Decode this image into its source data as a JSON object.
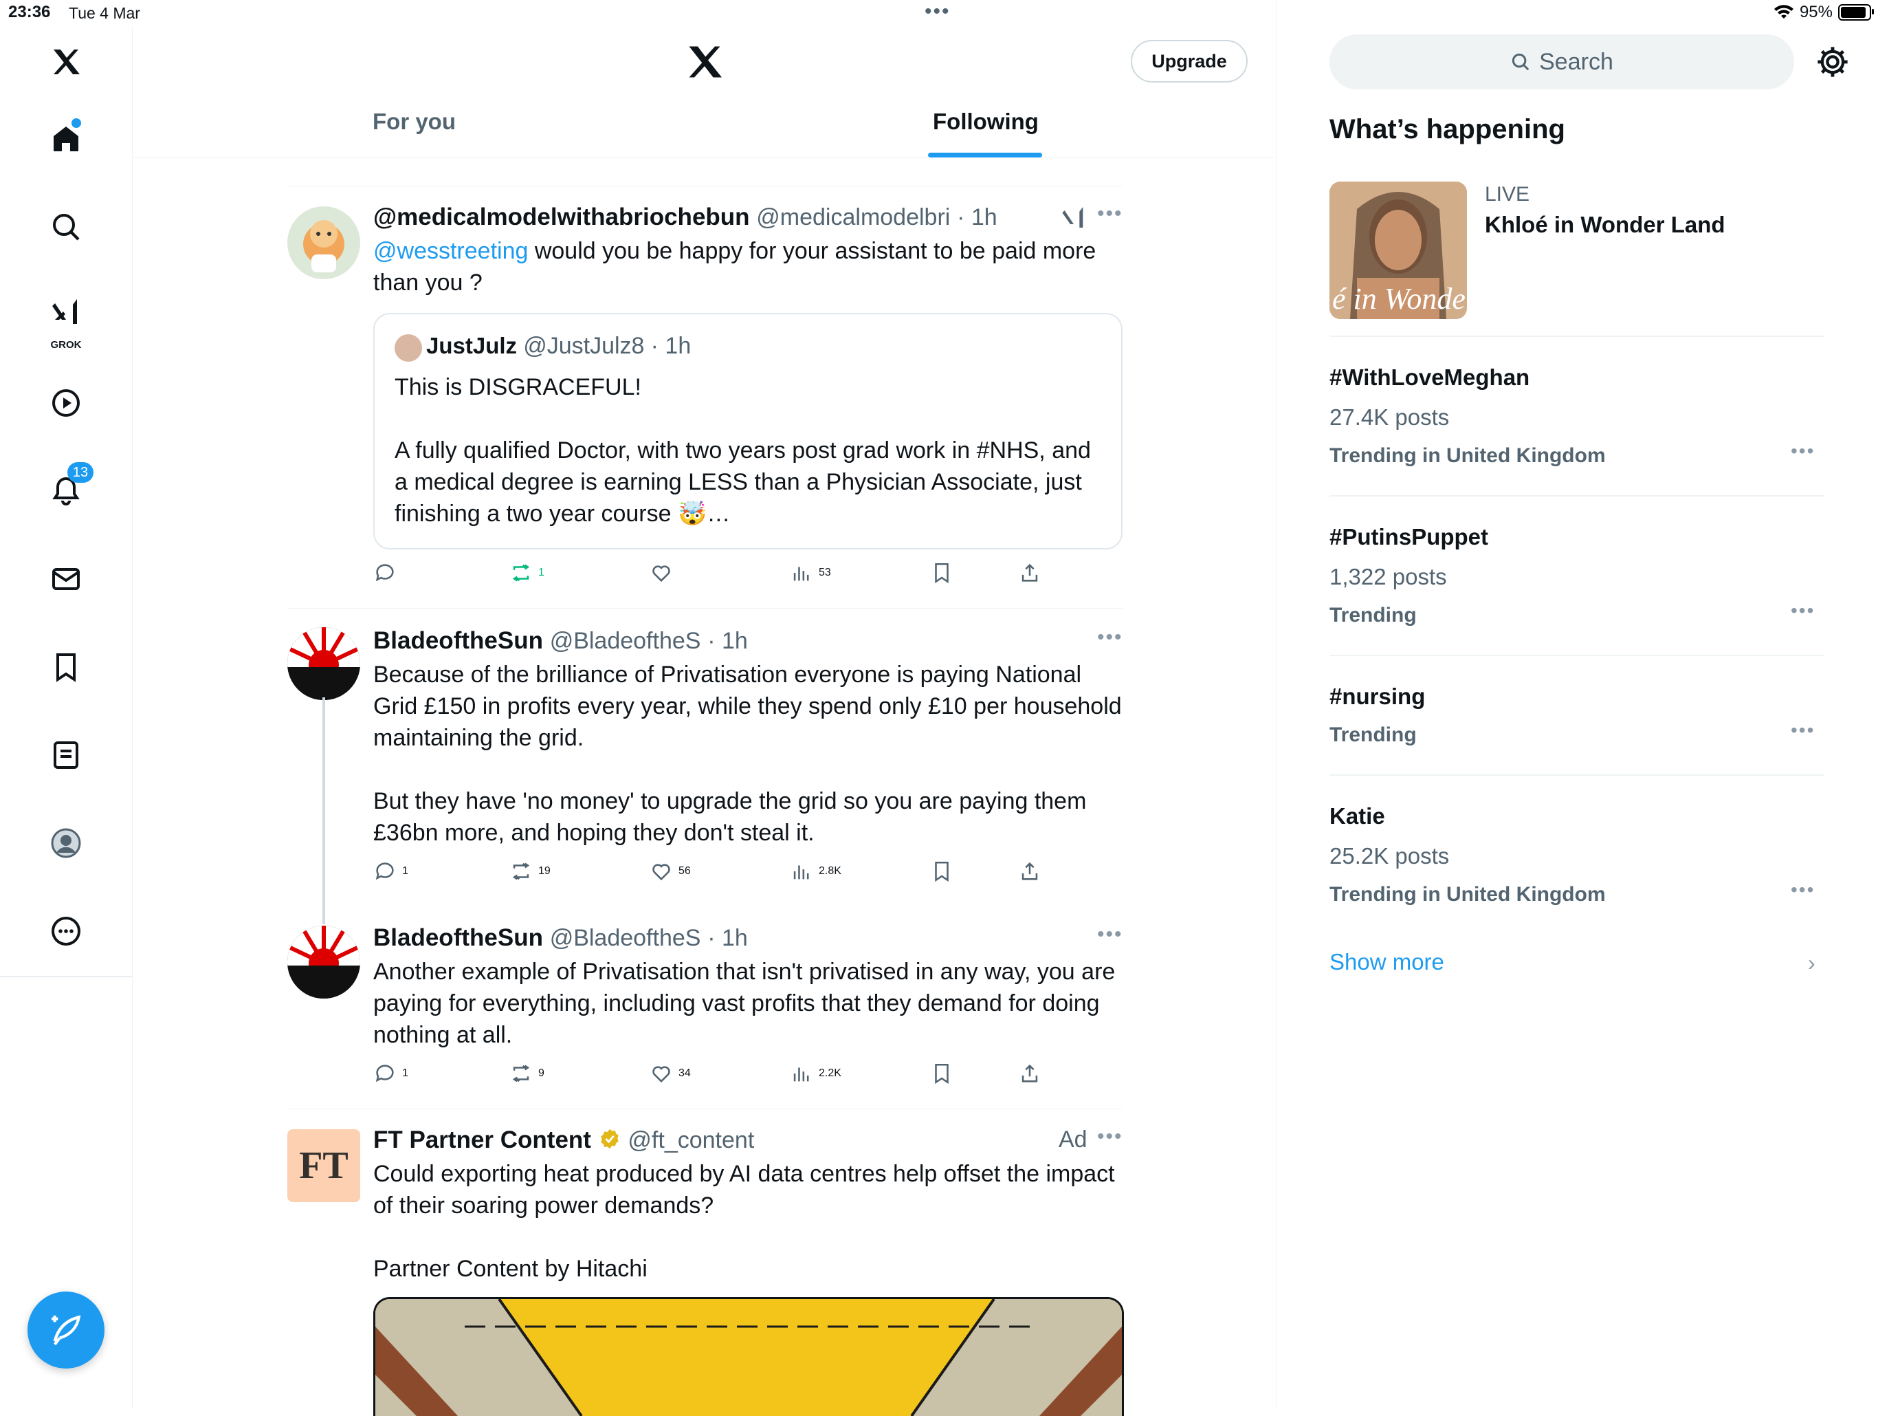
{
  "status": {
    "time": "23:36",
    "date": "Tue 4 Mar",
    "battery": "95%",
    "battery_level": 0.95
  },
  "nav": {
    "items": [
      "x-logo",
      "home",
      "search",
      "grok",
      "video",
      "notifications",
      "messages",
      "bookmarks",
      "lists",
      "profile",
      "more"
    ],
    "grok_label": "GROK",
    "notifications_badge": "13"
  },
  "header": {
    "upgrade_label": "Upgrade",
    "tabs": [
      {
        "label": "For you",
        "active": false
      },
      {
        "label": "Following",
        "active": true
      }
    ]
  },
  "feed": {
    "tweets": [
      {
        "name": "@medicalmodelwithabriochebun",
        "handle": "@medicalmodelbri",
        "time": "· 1h",
        "mention": "@wesstreeting",
        "text": " would you be happy for your assistant to be paid more than you ?",
        "quote": {
          "name": "JustJulz",
          "handle": "@JustJulz8",
          "time": "· 1h",
          "text": "This is DISGRACEFUL!\n\nA fully qualified Doctor, with two years post grad work in #NHS, and a medical degree is earning LESS than a Physician Associate, just finishing a two year course 🤯…"
        },
        "stats": {
          "replies": "",
          "reposts": "1",
          "likes": "",
          "views": "53"
        }
      },
      {
        "name": "BladeoftheSun",
        "handle": "@BladeoftheS",
        "time": "· 1h",
        "text": "Because of the brilliance of Privatisation everyone is paying National Grid £150 in profits every year, while they spend only £10 per household maintaining the grid.\n\nBut they have 'no money' to upgrade the grid so you are paying them £36bn more, and hoping they don't steal it.",
        "stats": {
          "replies": "1",
          "reposts": "19",
          "likes": "56",
          "views": "2.8K"
        }
      },
      {
        "name": "BladeoftheSun",
        "handle": "@BladeoftheS",
        "time": "· 1h",
        "text": "Another example of Privatisation that isn't privatised in any way, you are paying for everything, including vast profits that they demand for doing nothing at all.",
        "stats": {
          "replies": "1",
          "reposts": "9",
          "likes": "34",
          "views": "2.2K"
        }
      },
      {
        "name": "FT Partner Content",
        "handle": "@ft_content",
        "ad_label": "Ad",
        "avatar_text": "FT",
        "text": "Could exporting heat produced by AI data centres help offset the impact of their soaring power demands?\n\nPartner Content by Hitachi"
      }
    ]
  },
  "sidebar": {
    "search_placeholder": "Search",
    "title": "What’s happening",
    "live": {
      "label": "LIVE",
      "title": "Khloé in Wonder Land",
      "image_text": "é in Wonder L"
    },
    "trends": [
      {
        "title": "#WithLoveMeghan",
        "posts": "27.4K posts",
        "context": "Trending in United Kingdom"
      },
      {
        "title": "#PutinsPuppet",
        "posts": "1,322 posts",
        "context": "Trending"
      },
      {
        "title": "#nursing",
        "posts": "",
        "context": "Trending"
      },
      {
        "title": "Katie",
        "posts": "25.2K posts",
        "context": "Trending in United Kingdom"
      }
    ],
    "show_more": "Show more"
  },
  "colors": {
    "accent": "#1d9bf0",
    "text": "#0f1419",
    "muted": "#536471",
    "repost_active": "#00ba7c"
  }
}
